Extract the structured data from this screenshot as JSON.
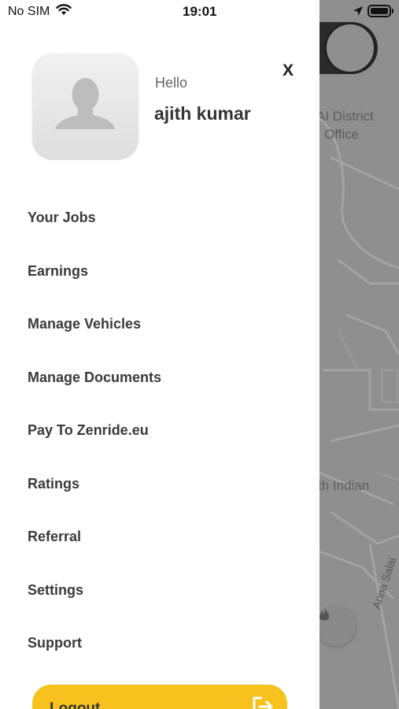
{
  "status_bar": {
    "carrier": "No SIM",
    "time": "19:01"
  },
  "drawer": {
    "greeting": "Hello",
    "user_name": "ajith kumar",
    "close_label": "X",
    "menu": [
      {
        "label": "Your Jobs"
      },
      {
        "label": "Earnings"
      },
      {
        "label": "Manage Vehicles"
      },
      {
        "label": "Manage Documents"
      },
      {
        "label": "Pay To Zenride.eu"
      },
      {
        "label": "Ratings"
      },
      {
        "label": "Referral"
      },
      {
        "label": "Settings"
      },
      {
        "label": "Support"
      }
    ],
    "logout_label": "Logout"
  },
  "map": {
    "labels": {
      "district": "AI District",
      "office": "Office",
      "indian": "th Indian",
      "road": "Anna Salai"
    }
  },
  "colors": {
    "accent": "#f7c21d",
    "overlay": "#8f8f8f",
    "menu_text": "#3a3a3a"
  },
  "icons": {
    "avatar": "person-silhouette-icon",
    "close": "close-icon",
    "logout": "logout-icon",
    "fab": "flame-icon",
    "wifi": "wifi-icon",
    "location": "location-arrow-icon"
  }
}
